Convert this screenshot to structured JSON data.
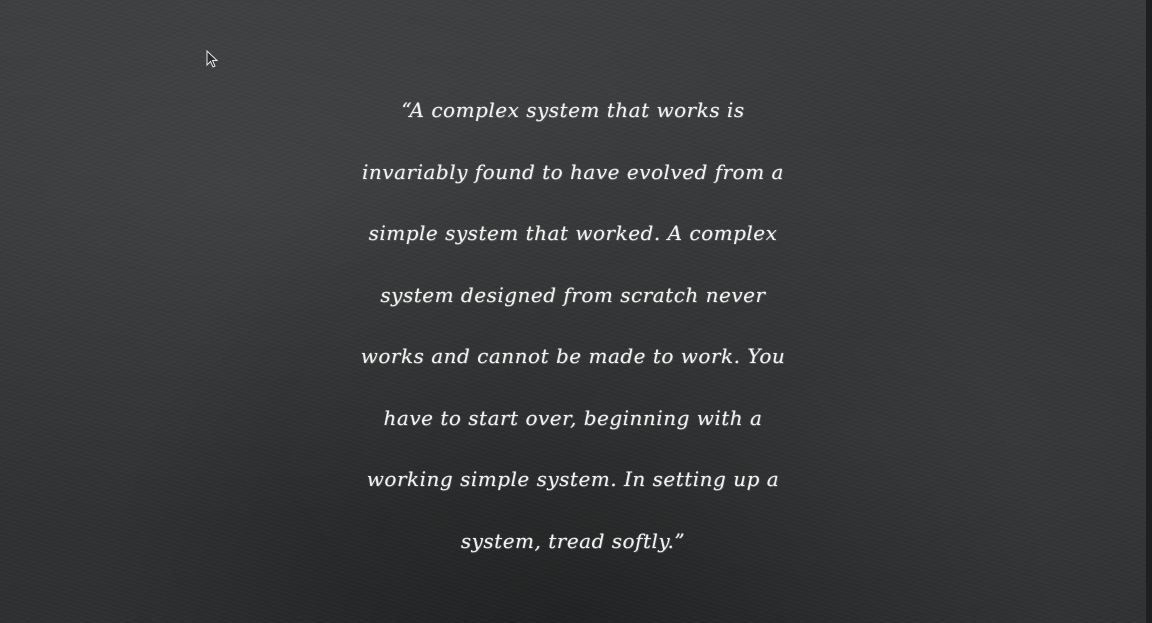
{
  "slide": {
    "background_color": "#333536",
    "text_color": "#f1f1ef",
    "quote_lines": [
      "“A complex system that works is",
      "invariably found to have evolved from a",
      "simple system that worked. A complex",
      "system designed from scratch never",
      "works and cannot be made to work. You",
      "have to start over, beginning with a",
      "working simple system. In setting up a",
      "system, tread softly.”"
    ]
  },
  "cursor": {
    "icon": "mouse-pointer-icon"
  }
}
